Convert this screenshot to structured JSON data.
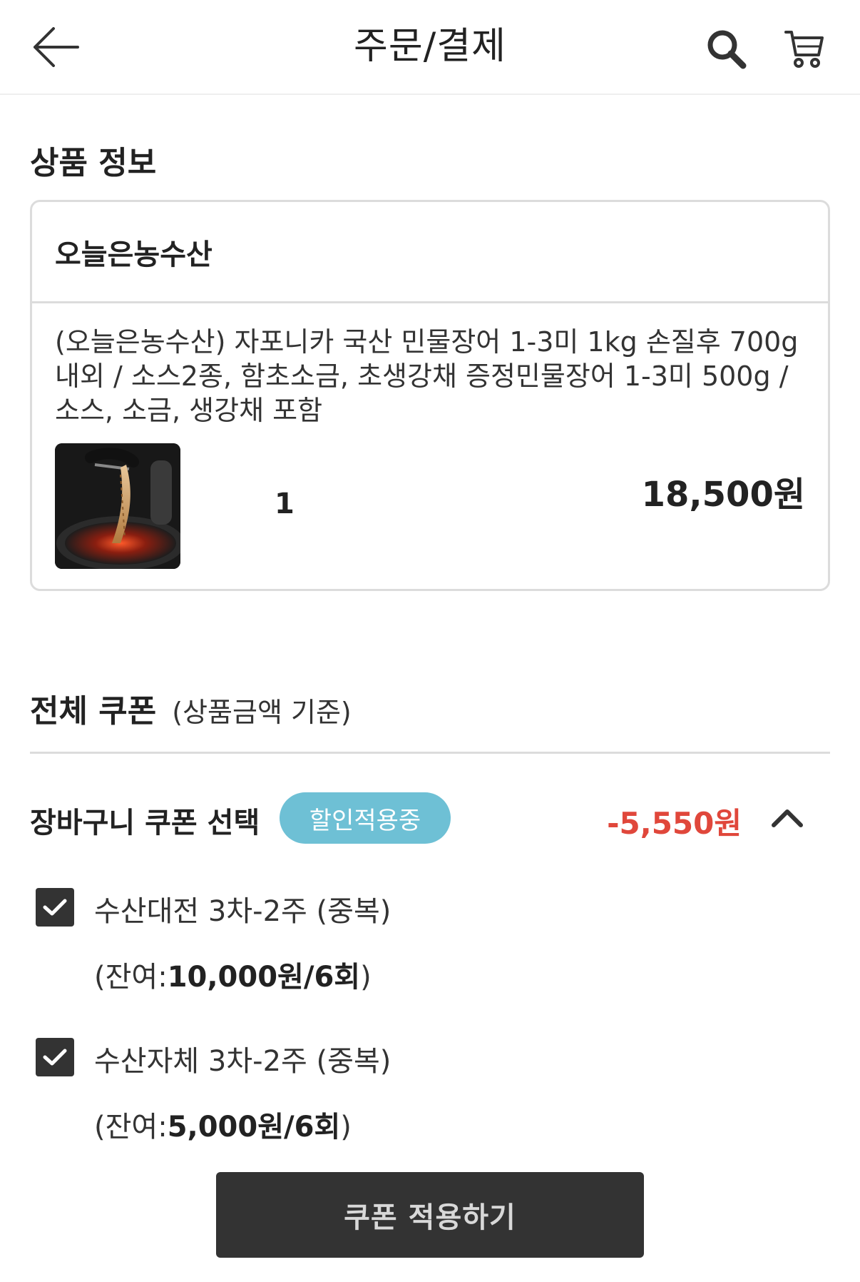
{
  "header": {
    "title": "주문/결제",
    "back_icon": "arrow-left-icon",
    "search_icon": "search-icon",
    "cart_icon": "cart-icon"
  },
  "product_section": {
    "title": "상품 정보",
    "seller": "오늘은농수산",
    "product_name": "(오늘은농수산) 자포니카 국산 민물장어 1-3미 1kg 손질후 700g 내외 / 소스2종, 함초소금, 초생강채 증정민물장어 1-3미 500g / 소스, 소금, 생강채 포함",
    "quantity": "1",
    "price": "18,500원"
  },
  "coupon_section": {
    "title": "전체 쿠폰",
    "subtitle": "(상품금액 기준)",
    "cart_coupon_label": "장바구니 쿠폰 선택",
    "badge": "할인적용중",
    "discount": "-5,550원",
    "items": [
      {
        "name": "수산대전 3차-2주 (중복)",
        "remain_prefix": "(잔여:",
        "remain_value": "10,000원/6회",
        "remain_suffix": ")",
        "checked": true
      },
      {
        "name": "수산자체 3차-2주 (중복)",
        "remain_prefix": "(잔여:",
        "remain_value": "5,000원/6회",
        "remain_suffix": ")",
        "checked": true
      }
    ],
    "apply_button": "쿠폰 적용하기"
  },
  "colors": {
    "badge": "#6ec0d5",
    "discount": "#e0473b",
    "button": "#333333"
  }
}
